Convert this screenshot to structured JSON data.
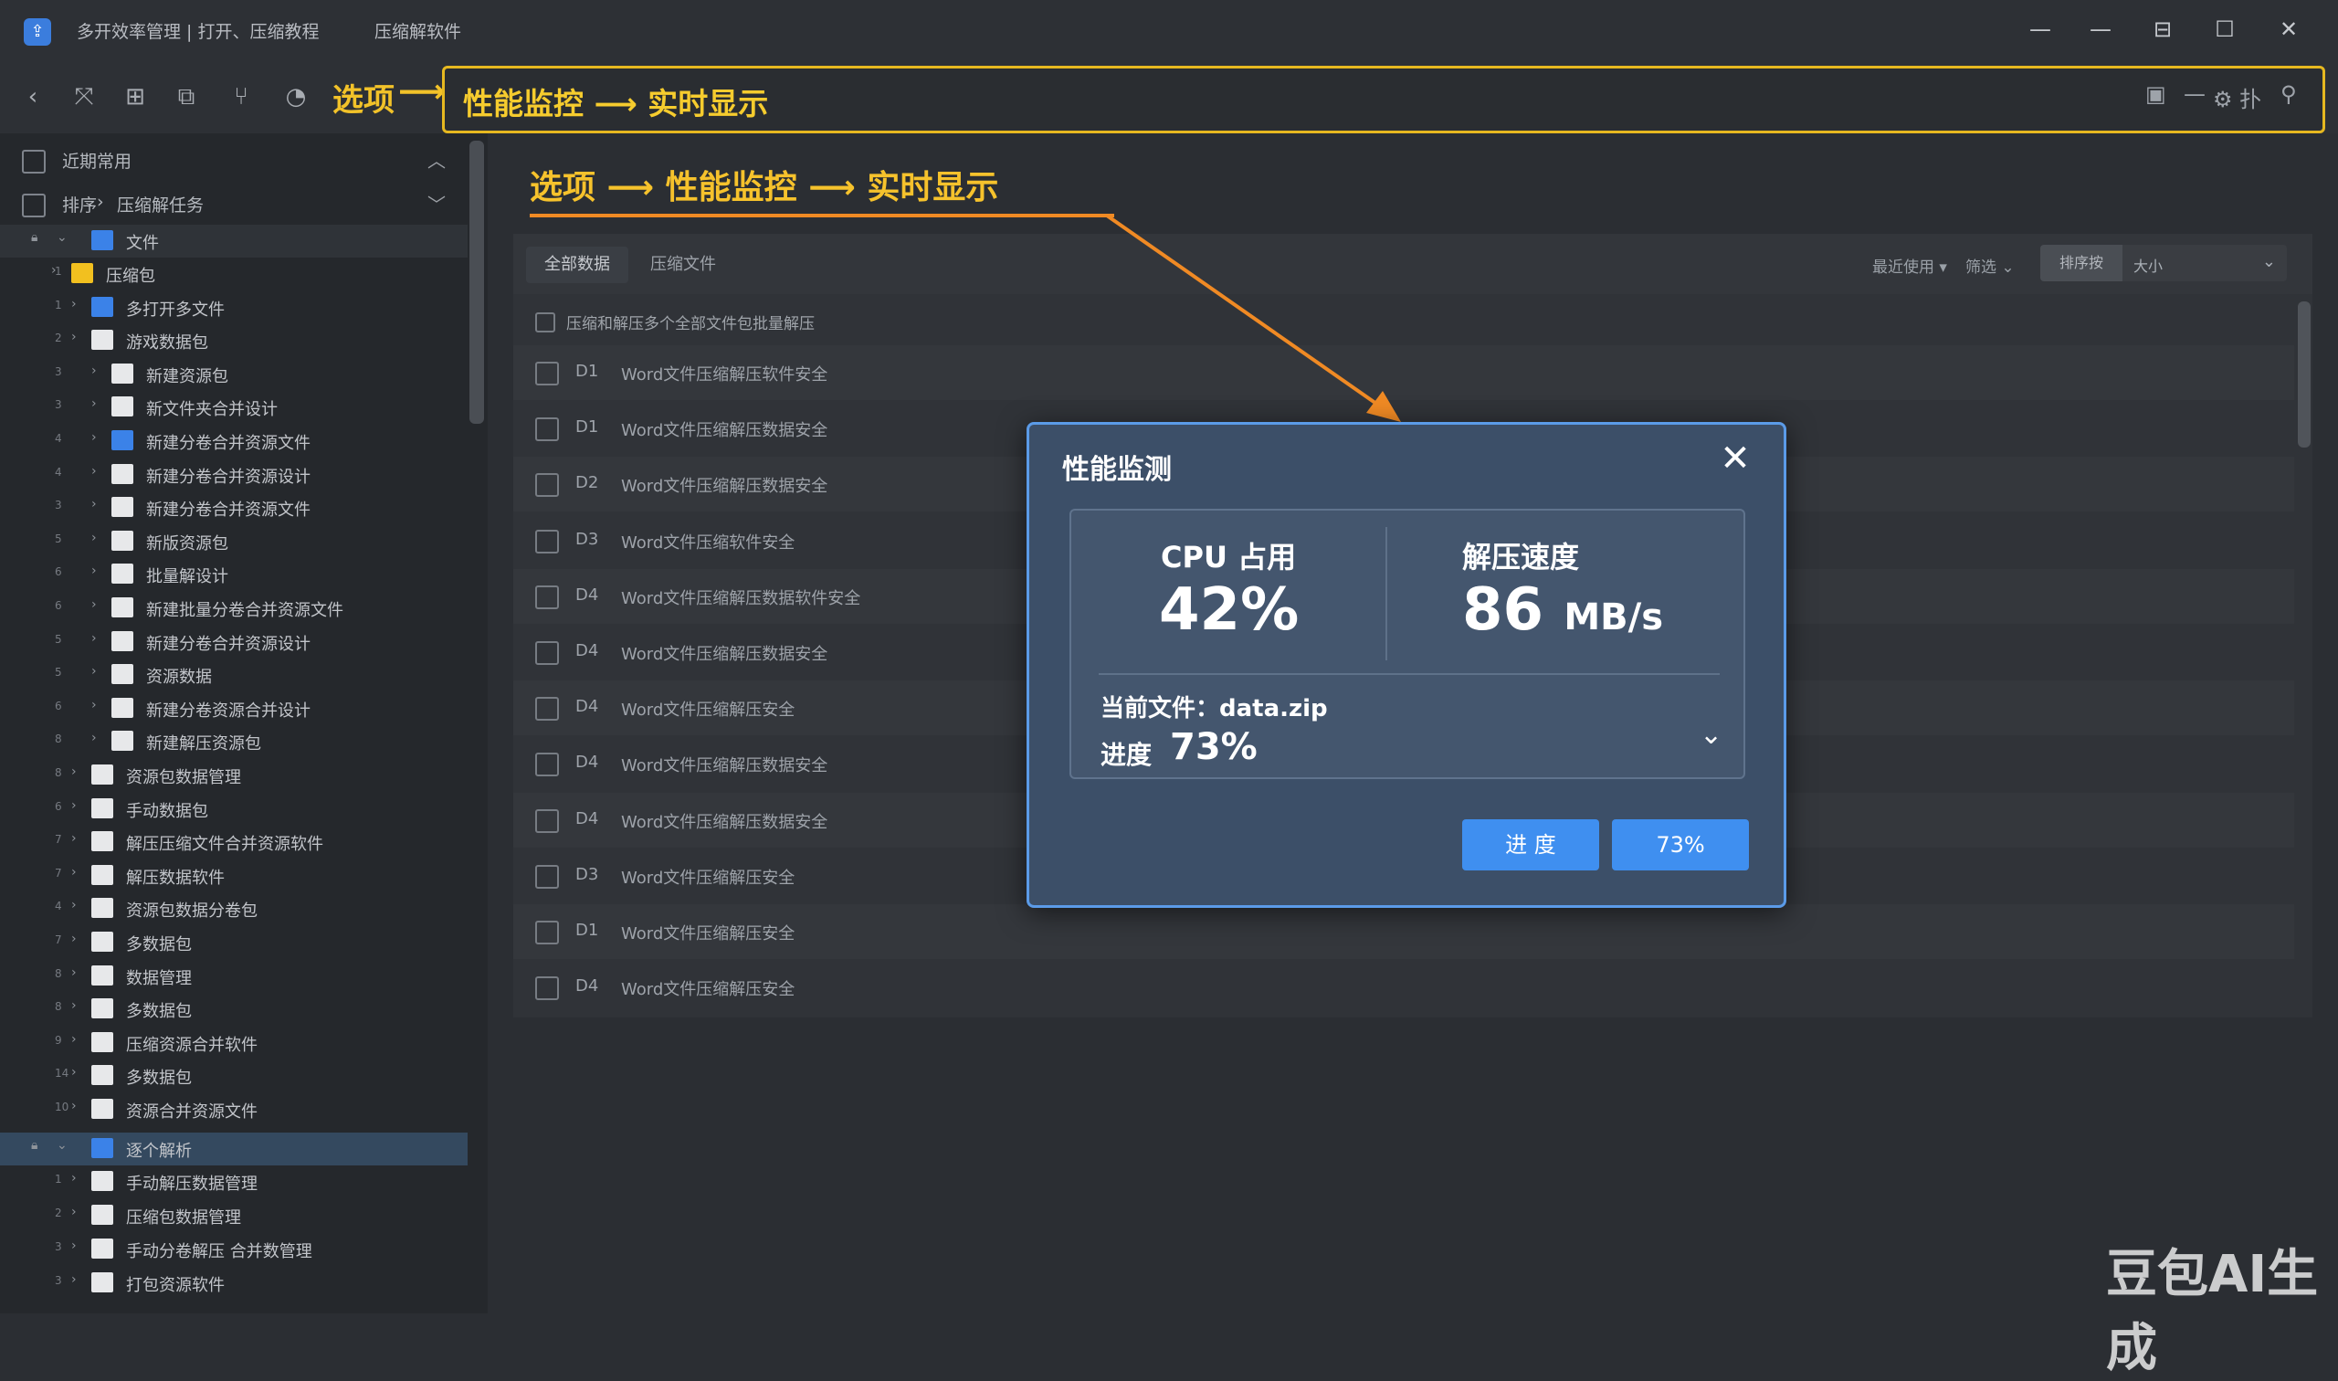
{
  "window": {
    "title_1": "多开效率管理 | 打开、压缩教程",
    "title_2": "压缩解软件",
    "controls": [
      "—",
      "—",
      "⊟",
      "☐",
      "✕"
    ]
  },
  "toolbar": {
    "icons": [
      "back-icon",
      "expand-icon",
      "grid-icon",
      "copy-icon",
      "split-icon",
      "timer-icon"
    ],
    "option_label": "选项",
    "arrow": "⟶",
    "path_text": "性能监控 ⟶ 实时显示",
    "right_tools": [
      "▣",
      "—",
      "⚙ 扑",
      "⚲"
    ]
  },
  "sidebar": {
    "section_1": "近期常用",
    "section_2_a": "排序",
    "section_2_sep": "›",
    "section_2_b": "压缩解任务",
    "root_1": "文件",
    "root_2": "逐个解析",
    "items": [
      {
        "num": "1",
        "label": "压缩包",
        "color": "yellow",
        "indent": 1
      },
      {
        "num": "1",
        "label": "多打开多文件",
        "color": "blue",
        "indent": 2
      },
      {
        "num": "2",
        "label": "游戏数据包",
        "color": "white",
        "indent": 2
      },
      {
        "num": "3",
        "label": "新建资源包",
        "color": "white",
        "indent": 3
      },
      {
        "num": "3",
        "label": "新文件夹合并设计",
        "color": "white",
        "indent": 3
      },
      {
        "num": "4",
        "label": "新建分卷合并资源文件",
        "color": "blue",
        "indent": 3
      },
      {
        "num": "4",
        "label": "新建分卷合并资源设计",
        "color": "white",
        "indent": 3
      },
      {
        "num": "3",
        "label": "新建分卷合并资源文件",
        "color": "white",
        "indent": 3
      },
      {
        "num": "5",
        "label": "新版资源包",
        "color": "white",
        "indent": 3
      },
      {
        "num": "6",
        "label": "批量解设计",
        "color": "white",
        "indent": 3
      },
      {
        "num": "6",
        "label": "新建批量分卷合并资源文件",
        "color": "white",
        "indent": 3
      },
      {
        "num": "5",
        "label": "新建分卷合并资源设计",
        "color": "white",
        "indent": 3
      },
      {
        "num": "5",
        "label": "资源数据",
        "color": "white",
        "indent": 3
      },
      {
        "num": "6",
        "label": "新建分卷资源合并设计",
        "color": "white",
        "indent": 3
      },
      {
        "num": "8",
        "label": "新建解压资源包",
        "color": "white",
        "indent": 3
      },
      {
        "num": "8",
        "label": "资源包数据管理",
        "color": "white",
        "indent": 2
      },
      {
        "num": "6",
        "label": "手动数据包",
        "color": "white",
        "indent": 2
      },
      {
        "num": "7",
        "label": "解压压缩文件合并资源软件",
        "color": "white",
        "indent": 2
      },
      {
        "num": "7",
        "label": "解压数据软件",
        "color": "white",
        "indent": 2
      },
      {
        "num": "4",
        "label": "资源包数据分卷包",
        "color": "white",
        "indent": 2
      },
      {
        "num": "7",
        "label": "多数据包",
        "color": "white",
        "indent": 2
      },
      {
        "num": "8",
        "label": "数据管理",
        "color": "white",
        "indent": 2
      },
      {
        "num": "8",
        "label": "多数据包",
        "color": "white",
        "indent": 2
      },
      {
        "num": "9",
        "label": "压缩资源合并软件",
        "color": "white",
        "indent": 2
      },
      {
        "num": "14",
        "label": "多数据包",
        "color": "white",
        "indent": 2
      },
      {
        "num": "10",
        "label": "资源合并资源文件",
        "color": "white",
        "indent": 2
      }
    ],
    "items_2": [
      {
        "num": "1",
        "label": "手动解压数据管理",
        "color": "white",
        "indent": 2
      },
      {
        "num": "2",
        "label": "压缩包数据管理",
        "color": "white",
        "indent": 2
      },
      {
        "num": "3",
        "label": "手动分卷解压 合并数管理",
        "color": "white",
        "indent": 2
      },
      {
        "num": "3",
        "label": "打包资源软件",
        "color": "white",
        "indent": 2
      }
    ]
  },
  "main": {
    "heading": "选项 ⟶ 性能监控 ⟶ 实时显示",
    "tabs": [
      "全部数据",
      "压缩文件"
    ],
    "filters": [
      "最近使用 ▾",
      "筛选 ⌄"
    ],
    "size_button": "排序按",
    "size_value": "大小",
    "select_all_label": "压缩和解压多个全部文件包批量解压",
    "rows": [
      {
        "id": "D1",
        "name": "Word文件压缩解压软件安全"
      },
      {
        "id": "D1",
        "name": "Word文件压缩解压数据安全"
      },
      {
        "id": "D2",
        "name": "Word文件压缩解压数据安全"
      },
      {
        "id": "D3",
        "name": "Word文件压缩软件安全"
      },
      {
        "id": "D4",
        "name": "Word文件压缩解压数据软件安全"
      },
      {
        "id": "D4",
        "name": "Word文件压缩解压数据安全"
      },
      {
        "id": "D4",
        "name": "Word文件压缩解压安全"
      },
      {
        "id": "D4",
        "name": "Word文件压缩解压数据安全"
      },
      {
        "id": "D4",
        "name": "Word文件压缩解压数据安全"
      },
      {
        "id": "D3",
        "name": "Word文件压缩解压安全"
      },
      {
        "id": "D1",
        "name": "Word文件压缩解压安全"
      },
      {
        "id": "D4",
        "name": "Word文件压缩解压安全"
      }
    ]
  },
  "dialog": {
    "title": "性能监测",
    "close": "✕",
    "cpu_label": "CPU 占用",
    "cpu_value": "42%",
    "speed_label": "解压速度",
    "speed_value": "86",
    "speed_unit": "MB/s",
    "file_label": "当前文件：data.zip",
    "progress_label": "进度",
    "progress_value": "73%",
    "chevron": "⌄",
    "button_1": "进 度",
    "button_2": "73%"
  },
  "watermark": "豆包AI生成",
  "colors": {
    "accent": "#3f8ff0",
    "highlight": "#f6c22c",
    "annotation_arrow": "#f08a24",
    "dialog_bg": "#3c4f68"
  }
}
